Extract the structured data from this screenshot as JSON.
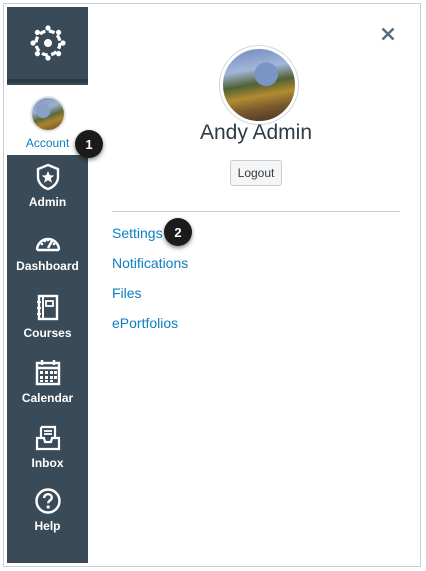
{
  "sidebar": {
    "account_label": "Account",
    "items": [
      {
        "label": "Admin",
        "icon": "admin-shield-icon"
      },
      {
        "label": "Dashboard",
        "icon": "dashboard-gauge-icon"
      },
      {
        "label": "Courses",
        "icon": "courses-book-icon"
      },
      {
        "label": "Calendar",
        "icon": "calendar-icon"
      },
      {
        "label": "Inbox",
        "icon": "inbox-icon"
      },
      {
        "label": "Help",
        "icon": "help-icon"
      }
    ]
  },
  "tray": {
    "user_name": "Andy Admin",
    "logout_label": "Logout",
    "links": [
      "Settings",
      "Notifications",
      "Files",
      "ePortfolios"
    ]
  },
  "callouts": [
    "1",
    "2"
  ],
  "colors": {
    "sidebar": "#394b58",
    "link": "#0b7ec1",
    "text": "#2d3b45"
  }
}
